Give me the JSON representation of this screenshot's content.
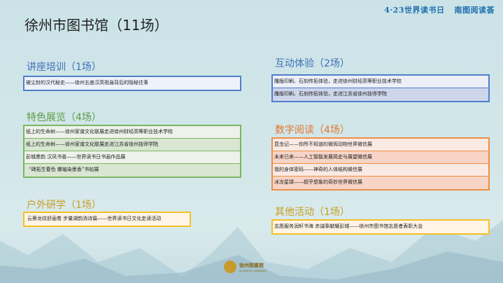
{
  "title": "徐州市图书馆（11场）",
  "banner": {
    "left": "4·23世界读书日",
    "right": "南图阅读荟"
  },
  "sections": {
    "lecture": {
      "heading": "讲座培训（1场）",
      "color": "#3e6fb8",
      "items": [
        "被尘封的汉代秘史——徐州五座汉高祖庙背后的隐秘往事"
      ]
    },
    "exhibition": {
      "heading": "特色展览（4场）",
      "color": "#5e9e45",
      "items": [
        "纸上的生命树——徐州家谱文化联展走进徐州财经高等职业技术学校",
        "纸上的生命树——徐州家谱文化联展走进江苏省徐州技师学院",
        "彭城墨韵 汉风书香——世界读书日书画作品展",
        "“碑拓生春色 螺蚰染墨香”书帖展"
      ]
    },
    "outdoor": {
      "heading": "户外研学（1场）",
      "color": "#c9a020",
      "items": [
        "云蔡龙纹舒画卷 步量湖韵淌诗篇——世界读书日文化走读活动"
      ]
    },
    "interactive": {
      "heading": "互动体验（2场）",
      "color": "#3e6fb8",
      "items": [
        "雕版印刷、石刻传拓体验，走进徐州财经高等职业技术学校",
        "雕版印刷、石刻传拓体验，走进江苏省徐州技师学院"
      ]
    },
    "digital": {
      "heading": "数字阅读（4场）",
      "color": "#e2762b",
      "items": [
        "昆虫记——你所不知道的微观动物世界微信展",
        "未来已来——人工智能发展简史与展望微信展",
        "我的身体密码——神奇的人体结构微信展",
        "冰冻星球——超乎想象的奇妙世界微信展"
      ]
    },
    "other": {
      "heading": "其他活动（1场）",
      "color": "#c9a020",
      "items": [
        "志愿服务润轩书海 赤诚奉献耀彭城——徐州市图书馆志愿者表彰大会"
      ]
    }
  },
  "logo": {
    "name": "徐州图書館",
    "en": "XUZHOU LIBRARY"
  }
}
